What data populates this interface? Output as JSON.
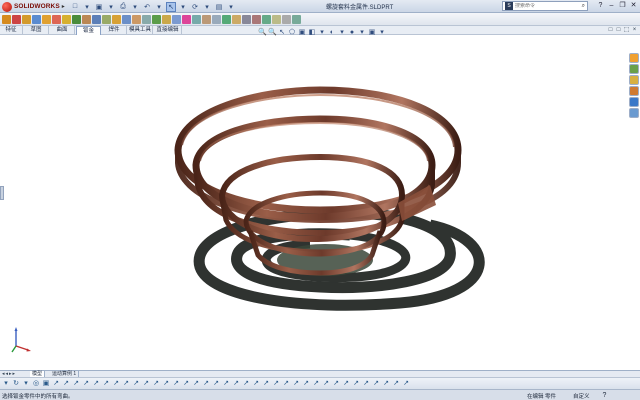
{
  "app": {
    "logo_text": "SOLIDWORKS",
    "logo_arrow": "▸",
    "document_title": "螺旋套料金属件.SLDPRT"
  },
  "quick_access": {
    "icons": [
      "new-icon",
      "open-icon",
      "save-icon",
      "print-icon",
      "undo-icon",
      "select-icon",
      "rebuild-icon",
      "options-icon"
    ],
    "glyphs": [
      "□",
      "▾",
      "▣",
      "▾",
      "⎙",
      "▾",
      "↶",
      "▾",
      "↖",
      "▾",
      "⟳",
      "▾",
      "▤",
      "▾"
    ]
  },
  "search": {
    "placeholder": "搜索命令",
    "value": "",
    "icon_label": "S",
    "mag_glyph": "⌕"
  },
  "window_controls": {
    "help": "?",
    "minimize": "–",
    "restore": "❐",
    "close": "✕"
  },
  "command_icons": {
    "colors": [
      "#d58a1e",
      "#c44",
      "#d39a2c",
      "#5a8bd0",
      "#e0a030",
      "#d65",
      "#d6b030",
      "#4a8c3c",
      "#b85",
      "#5c7fb8",
      "#9a6",
      "#d7a135",
      "#6b8fc8",
      "#c96",
      "#8aa",
      "#5b9d4a",
      "#caa84a",
      "#7b9ad0",
      "#d49",
      "#7aa",
      "#b97",
      "#9ab",
      "#5a7",
      "#ca6",
      "#889",
      "#a77",
      "#6a8",
      "#bb8",
      "#aaa",
      "#7a9"
    ]
  },
  "tabs": {
    "items": [
      "特征",
      "草图",
      "曲面",
      "钣金",
      "焊件",
      "模具工具",
      "直接编辑"
    ],
    "active_index": 3,
    "right_icons": [
      "□",
      "□",
      "⬚",
      "×"
    ]
  },
  "hud": {
    "glyphs": [
      "🔍",
      "🔍",
      "↖",
      "⬠",
      "▣",
      "◧",
      "▾",
      "◐",
      "▾",
      "●",
      "▾",
      "▣",
      "▾"
    ],
    "names": [
      "zoom-to-fit-icon",
      "zoom-area-icon",
      "previous-view-icon",
      "section-view-icon",
      "view-orientation-icon",
      "display-style-icon",
      "display-style-dropdown-icon",
      "hide-show-icon",
      "hide-show-dropdown-icon",
      "appearance-icon",
      "appearance-dropdown-icon",
      "scene-icon",
      "scene-dropdown-icon"
    ]
  },
  "task_pane": {
    "buttons": [
      {
        "name": "resources-icon",
        "color": "#f0a030"
      },
      {
        "name": "design-library-icon",
        "color": "#6aa04a"
      },
      {
        "name": "file-explorer-icon",
        "color": "#d8b040"
      },
      {
        "name": "view-palette-icon",
        "color": "#d07a30"
      },
      {
        "name": "appearances-icon",
        "color": "#3a78c8"
      },
      {
        "name": "custom-properties-icon",
        "color": "#6a9ad0"
      }
    ]
  },
  "bottom_tabs": {
    "nav_glyphs": "◂◂▸▸",
    "items": [
      "模型",
      "运动算例 1"
    ],
    "active_index": 0
  },
  "view_tools": {
    "glyphs": [
      "▾",
      "↻",
      "▾",
      "◎",
      "▣",
      "↗",
      "↗",
      "↗",
      "↗",
      "↗",
      "↗",
      "↗",
      "↗",
      "↗",
      "↗",
      "↗",
      "↗",
      "↗",
      "↗",
      "↗",
      "↗",
      "↗",
      "↗",
      "↗",
      "↗",
      "↗",
      "↗",
      "↗",
      "↗",
      "↗",
      "↗",
      "↗",
      "↗",
      "↗",
      "↗",
      "↗",
      "↗",
      "↗",
      "↗",
      "↗",
      "↗"
    ]
  },
  "status": {
    "message": "选择钣金零件中的所有弯曲。",
    "mode": "在编辑 零件",
    "units": "自定义",
    "help": "?"
  },
  "colors": {
    "copper_dark": "#3a1a12",
    "copper_mid": "#7a4434",
    "copper_light": "#b97d65",
    "shadow": "#2f3330"
  }
}
